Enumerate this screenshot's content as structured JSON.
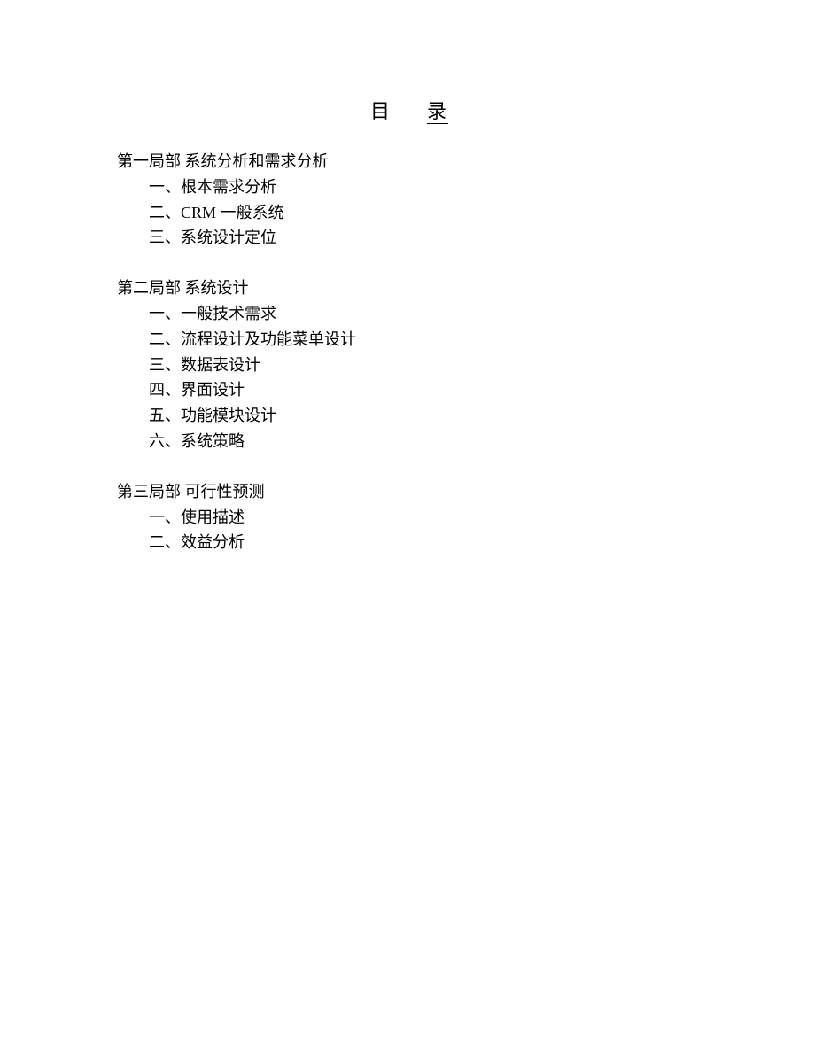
{
  "title": {
    "char1": "目",
    "char2": "录"
  },
  "sections": [
    {
      "heading": "第一局部 系统分析和需求分析",
      "items": [
        "一、根本需求分析",
        "二、CRM 一般系统",
        "三、系统设计定位"
      ]
    },
    {
      "heading": "第二局部 系统设计",
      "items": [
        "一、一般技术需求",
        "二、流程设计及功能菜单设计",
        "三、数据表设计",
        "四、界面设计",
        "五、功能模块设计",
        "六、系统策略"
      ]
    },
    {
      "heading": "第三局部 可行性预测",
      "items": [
        "一、使用描述",
        "二、效益分析"
      ]
    }
  ]
}
